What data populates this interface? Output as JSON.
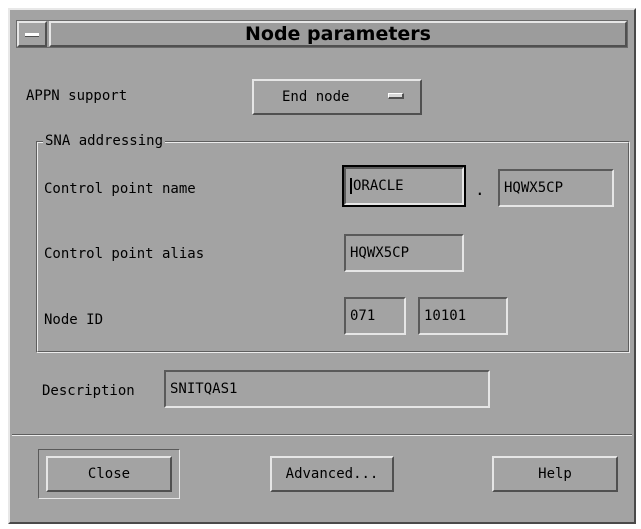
{
  "window": {
    "title": "Node parameters"
  },
  "appn": {
    "label": "APPN support",
    "value": "End node"
  },
  "sna": {
    "group_title": "SNA addressing",
    "cp_name_label": "Control point name",
    "cp_name_network": "ORACLE",
    "cp_name_separator": ".",
    "cp_name_value": "HQWX5CP",
    "cp_alias_label": "Control point alias",
    "cp_alias_value": "HQWX5CP",
    "node_id_label": "Node ID",
    "node_id_block": "071",
    "node_id_number": "10101"
  },
  "description": {
    "label": "Description",
    "value": "SNITQAS1"
  },
  "buttons": {
    "close": "Close",
    "advanced": "Advanced...",
    "help": "Help"
  },
  "icons": {
    "window_menu": "window-menu-icon",
    "option_indicator": "option-menu-indicator-icon"
  }
}
